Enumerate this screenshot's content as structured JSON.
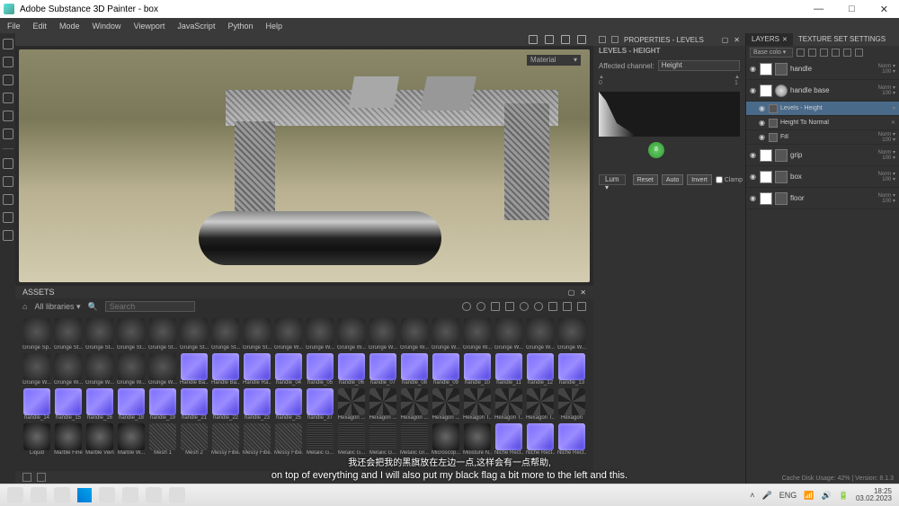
{
  "window": {
    "title": "Adobe Substance 3D Painter - box"
  },
  "menu": [
    "File",
    "Edit",
    "Mode",
    "Window",
    "Viewport",
    "JavaScript",
    "Python",
    "Help"
  ],
  "viewport": {
    "material_dropdown": "Material"
  },
  "properties": {
    "tab": "PROPERTIES - LEVELS",
    "subtitle": "LEVELS - HEIGHT",
    "affected_label": "Affected channel:",
    "affected_value": "Height",
    "marker_a": "0",
    "marker_b": "1",
    "lum": "Lum",
    "reset": "Reset",
    "auto": "Auto",
    "invert": "Invert",
    "clamp": "Clamp",
    "badge": "8"
  },
  "layers": {
    "tab1": "LAYERS",
    "tab2": "TEXTURE SET SETTINGS",
    "mode": "Base colo",
    "items": [
      {
        "name": "handle",
        "blend": "Norm",
        "op": "100"
      },
      {
        "name": "handle base",
        "blend": "Norm",
        "op": "100"
      },
      {
        "name": "Levels - Height",
        "blend": "",
        "op": "",
        "sub": true,
        "sel": true
      },
      {
        "name": "Height To Normal",
        "blend": "",
        "op": "",
        "sub": true
      },
      {
        "name": "Fill",
        "blend": "Norm",
        "op": "100",
        "sub": true
      },
      {
        "name": "grip",
        "blend": "Norm",
        "op": "100"
      },
      {
        "name": "box",
        "blend": "Norm",
        "op": "100"
      },
      {
        "name": "floor",
        "blend": "Norm",
        "op": "100"
      }
    ]
  },
  "assets": {
    "title": "ASSETS",
    "lib": "All libraries",
    "search_ph": "Search",
    "row1": [
      "Grunge Sp...",
      "Grunge St...",
      "Grunge St...",
      "Grunge St...",
      "Grunge St...",
      "Grunge St...",
      "Grunge St...",
      "Grunge St...",
      "Grunge W...",
      "Grunge W...",
      "Grunge W...",
      "Grunge W...",
      "Grunge W...",
      "Grunge W...",
      "Grunge W...",
      "Grunge W...",
      "Grunge W...",
      "Grunge W..."
    ],
    "row2": [
      "Grunge W...",
      "Grunge W...",
      "Grunge W...",
      "Grunge W...",
      "Grunge W...",
      "Handle Ba...",
      "Handle Ba...",
      "Handle Ra...",
      "handle_04",
      "handle_05",
      "handle_06",
      "handle_07",
      "handle_08",
      "handle_09",
      "handle_10",
      "handle_11",
      "handle_12",
      "handle_13"
    ],
    "row3": [
      "handle_14",
      "handle_15",
      "handle_16",
      "handle_18",
      "handle_19",
      "handle_21",
      "handle_22",
      "handle_23",
      "handle_25",
      "handle_37",
      "Hexagon ...",
      "Hexagon ...",
      "Hexagon ...",
      "Hexagon ...",
      "Hexagon T...",
      "Hexagon T...",
      "Hexagon T...",
      "Hexagon"
    ],
    "row4": [
      "Liquid",
      "Marble Fine",
      "Marble Vein",
      "Marble W...",
      "Mesh 1",
      "Mesh 2",
      "Messy Fibe...",
      "Messy Fibe...",
      "Messy Fibe...",
      "Metalic G...",
      "Metalic G...",
      "Metalic G...",
      "Metalic Gr...",
      "Microscop...",
      "Moisture N...",
      "Niche Rect...",
      "Niche Rect...",
      "Niche Rect..."
    ]
  },
  "status": {
    "cache": "Cache Disk Usage:   42% | Version: 8.1.3"
  },
  "subtitles": {
    "cn": "我还会把我的黑旗放在左边一点,这样会有一点帮助,",
    "en": "on top of everything and I will also put my black flag a bit more to the left and this."
  },
  "taskbar": {
    "lang": "ENG",
    "time": "18:25",
    "date": "03.02.2023"
  }
}
